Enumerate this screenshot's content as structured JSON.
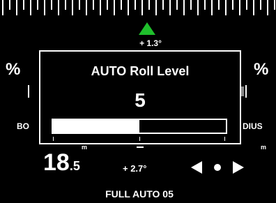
{
  "scale": {
    "icon": "tick-ruler"
  },
  "pitch_top": {
    "icon": "green-up-arrow-icon",
    "value": "+ 1.3°",
    "color": "#1fbf2c"
  },
  "left_percent": "%",
  "right_percent": "%",
  "left_label": "BO",
  "right_label": "DIUS",
  "speed": {
    "integer": "18",
    "decimal": ".5",
    "unit": "m"
  },
  "right_unit": "m",
  "pitch_bottom": "+ 2.7°",
  "nav_arrows": {
    "left_icon": "left-arrow-icon",
    "dot_icon": "dot-icon",
    "right_icon": "right-arrow-icon"
  },
  "footer_mode": "FULL AUTO 05",
  "dialog": {
    "title": "AUTO Roll Level",
    "value": "5",
    "level_fraction": 0.5
  }
}
